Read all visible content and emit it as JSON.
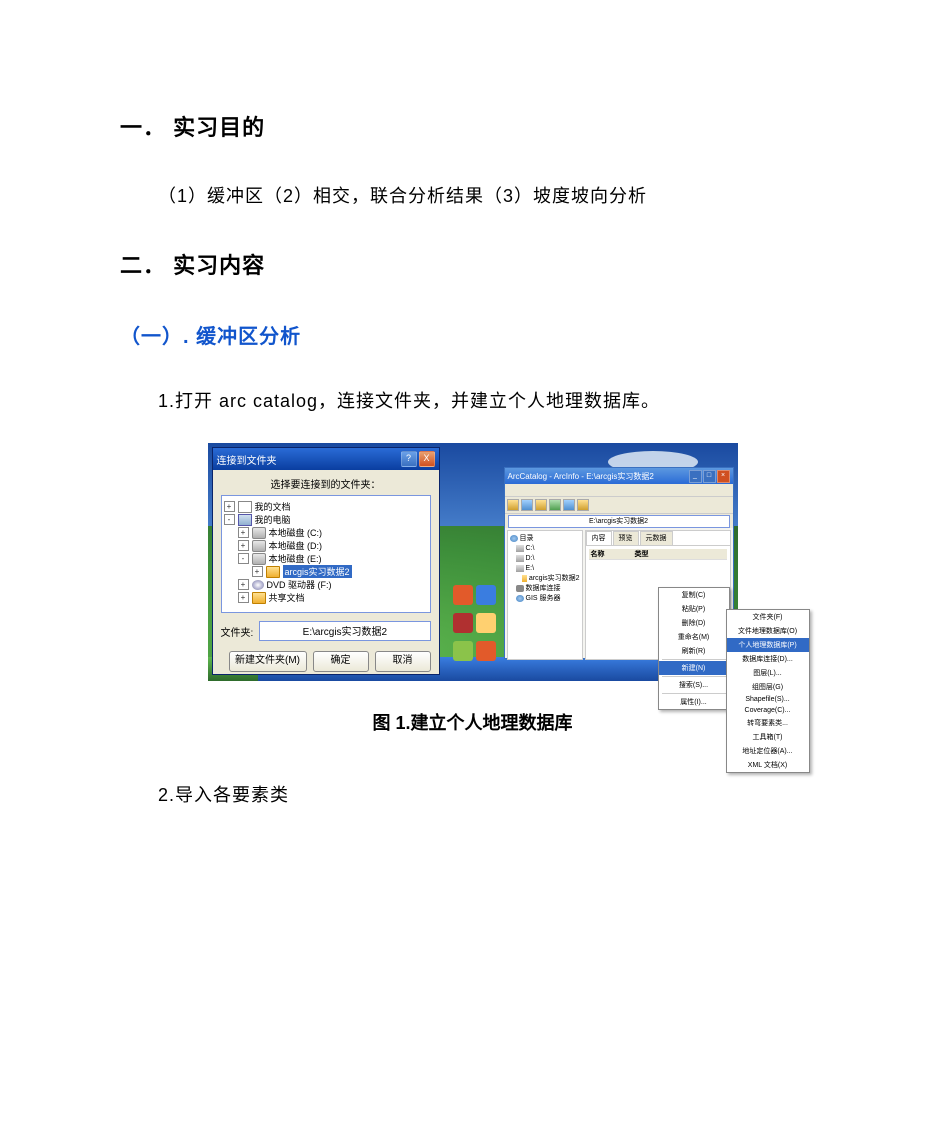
{
  "headings": {
    "h1": "一． 实习目的",
    "h2": "二． 实习内容",
    "sub1": "（一）. 缓冲区分析"
  },
  "paragraphs": {
    "p1": "（1）缓冲区（2）相交，联合分析结果（3）坡度坡向分析",
    "step1": "1.打开 arc catalog，连接文件夹，并建立个人地理数据库。",
    "caption1": "图 1.建立个人地理数据库",
    "step2": "2.导入各要素类"
  },
  "dialog": {
    "title": "连接到文件夹",
    "help": "?",
    "close": "X",
    "instruction": "选择要连接到的文件夹：",
    "tree": {
      "mydocs": "我的文档",
      "mypc": "我的电脑",
      "driveC": "本地磁盘 (C:)",
      "driveD": "本地磁盘 (D:)",
      "driveE": "本地磁盘 (E:)",
      "selected": "arcgis实习数据2",
      "dvd": "DVD 驱动器 (F:)",
      "shared": "共享文档"
    },
    "path_label": "文件夹:",
    "path_value": "E:\\arcgis实习数据2",
    "btn_new": "新建文件夹(M)",
    "btn_ok": "确定",
    "btn_cancel": "取消"
  },
  "arc": {
    "title": "ArcCatalog - ArcInfo - E:\\arcgis实习数据2",
    "addr": "E:\\arcgis实习数据2",
    "tabs": {
      "contents": "内容",
      "preview": "预览",
      "metadata": "元数据"
    },
    "cols": {
      "name": "名称",
      "type": "类型"
    },
    "side": {
      "catalog": "目录",
      "c": "C:\\",
      "d": "D:\\",
      "e": "E:\\",
      "data": "arcgis实习数据2",
      "conn": "数据库连接",
      "gis": "GIS 服务器"
    },
    "ctx": {
      "copy": "复制(C)",
      "paste": "粘贴(P)",
      "delete": "删除(D)",
      "rename": "重命名(M)",
      "refresh": "刷新(R)",
      "new": "新建(N)",
      "search": "搜索(S)...",
      "props": "属性(I)..."
    },
    "submenu": {
      "folder": "文件夹(F)",
      "fgdb": "文件地理数据库(O)",
      "pgdb": "个人地理数据库(P)",
      "dbconn": "数据库连接(D)...",
      "layer": "图层(L)...",
      "grplayer": "组图层(G)",
      "shapefile": "Shapefile(S)...",
      "coverage": "Coverage(C)...",
      "turn": "转弯要素类...",
      "toolbox": "工具箱(T)",
      "address": "地址定位器(A)...",
      "xml": "XML 文档(X)"
    }
  }
}
